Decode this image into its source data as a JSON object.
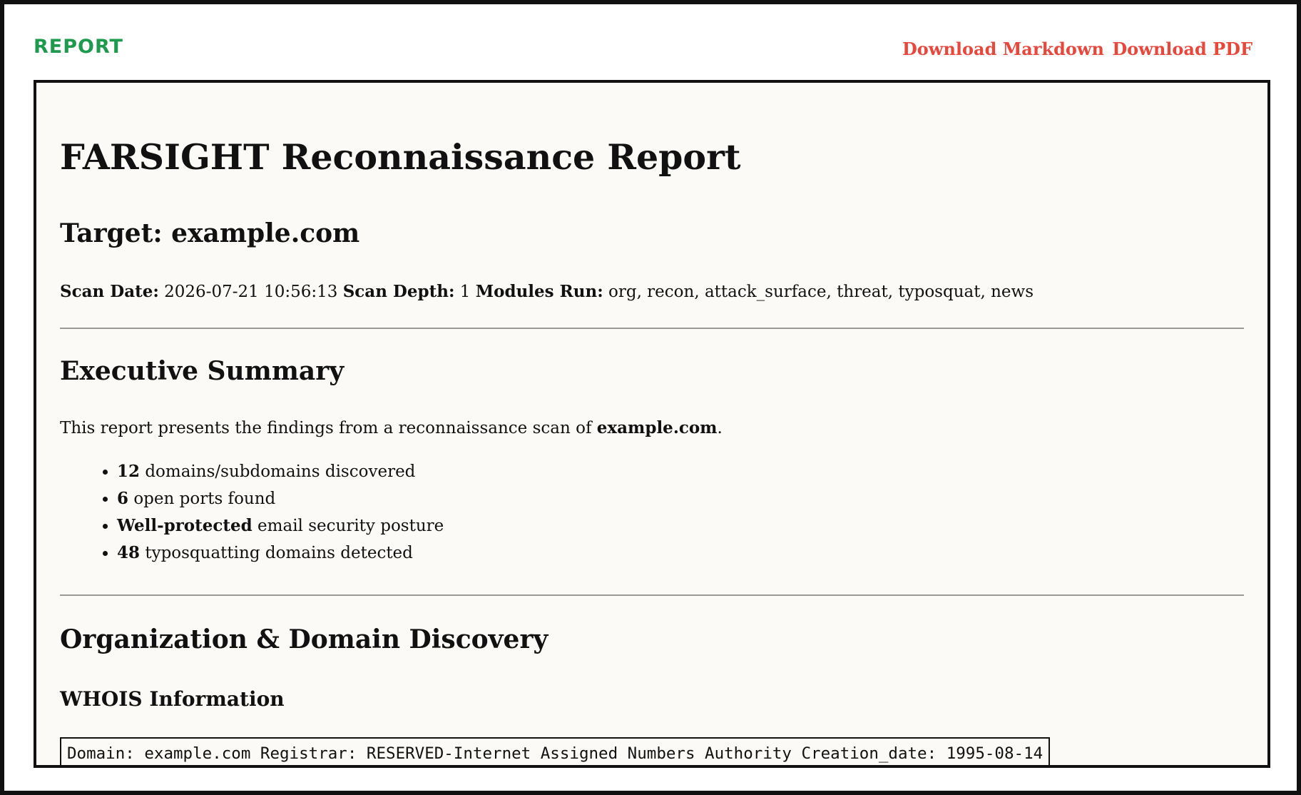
{
  "header": {
    "brand": "REPORT",
    "download_markdown": "Download Markdown",
    "download_pdf": "Download PDF"
  },
  "report": {
    "title": "FARSIGHT Reconnaissance Report",
    "target_heading": "Target: example.com",
    "meta": {
      "scan_date_label": "Scan Date:",
      "scan_date_value": "2026-07-21 10:56:13",
      "scan_depth_label": "Scan Depth:",
      "scan_depth_value": "1",
      "modules_label": "Modules Run:",
      "modules_value": "org, recon, attack_surface, threat, typosquat, news"
    },
    "executive_summary": {
      "heading": "Executive Summary",
      "intro_prefix": "This report presents the findings from a reconnaissance scan of ",
      "intro_domain": "example.com",
      "intro_suffix": ".",
      "items": [
        {
          "strong": "12",
          "text": " domains/subdomains discovered"
        },
        {
          "strong": "6",
          "text": " open ports found"
        },
        {
          "strong": "Well-protected",
          "text": " email security posture"
        },
        {
          "strong": "48",
          "text": " typosquatting domains detected"
        }
      ]
    },
    "org_discovery": {
      "heading": "Organization & Domain Discovery",
      "whois_heading": "WHOIS Information",
      "whois_code": "Domain: example.com Registrar: RESERVED-Internet Assigned Numbers Authority Creation_date: 1995-08-14"
    }
  }
}
